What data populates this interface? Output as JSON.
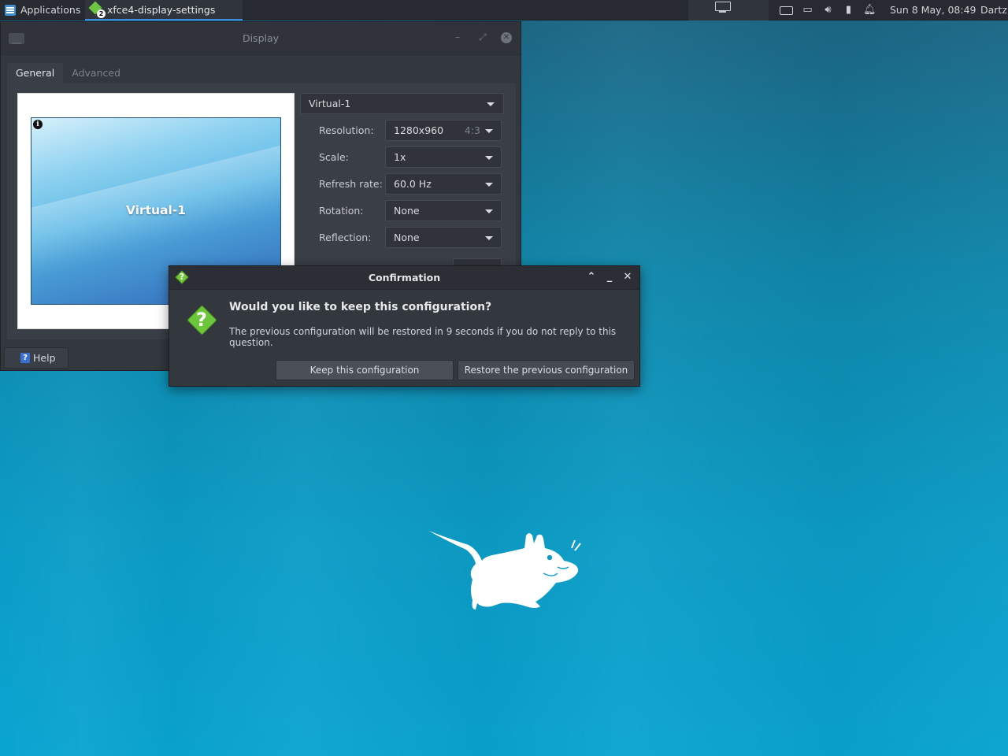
{
  "panel": {
    "applications_label": "Applications",
    "task_title": "xfce4-display-settings",
    "task_badge": "2",
    "clock": "Sun  8 May, 08:49",
    "user": "Dartz"
  },
  "display_window": {
    "title": "Display",
    "tabs": [
      {
        "label": "General",
        "active": true
      },
      {
        "label": "Advanced",
        "active": false
      }
    ],
    "preview": {
      "monitor_label": "Virtual-1",
      "info_glyph": "i"
    },
    "output_selected": "Virtual-1",
    "settings": [
      {
        "label": "Resolution:",
        "value": "1280x960",
        "aspect": "4:3"
      },
      {
        "label": "Scale:",
        "value": "1x"
      },
      {
        "label": "Refresh rate:",
        "value": "60.0 Hz"
      },
      {
        "label": "Rotation:",
        "value": "None"
      },
      {
        "label": "Reflection:",
        "value": "None"
      }
    ],
    "help_label": "Help"
  },
  "dialog": {
    "title": "Confirmation",
    "heading": "Would you like to keep this configuration?",
    "message": "The previous configuration will be restored in 9 seconds if you do not reply to this question.",
    "keep_label": "Keep this configuration",
    "restore_label": "Restore the previous configuration",
    "question_glyph": "?"
  },
  "colors": {
    "panel_bg": "#272a30",
    "window_bg": "#33373e",
    "accent": "#3d8ee0",
    "question_green": "#6cc63a",
    "desktop_blue": "#0aa3d1"
  }
}
